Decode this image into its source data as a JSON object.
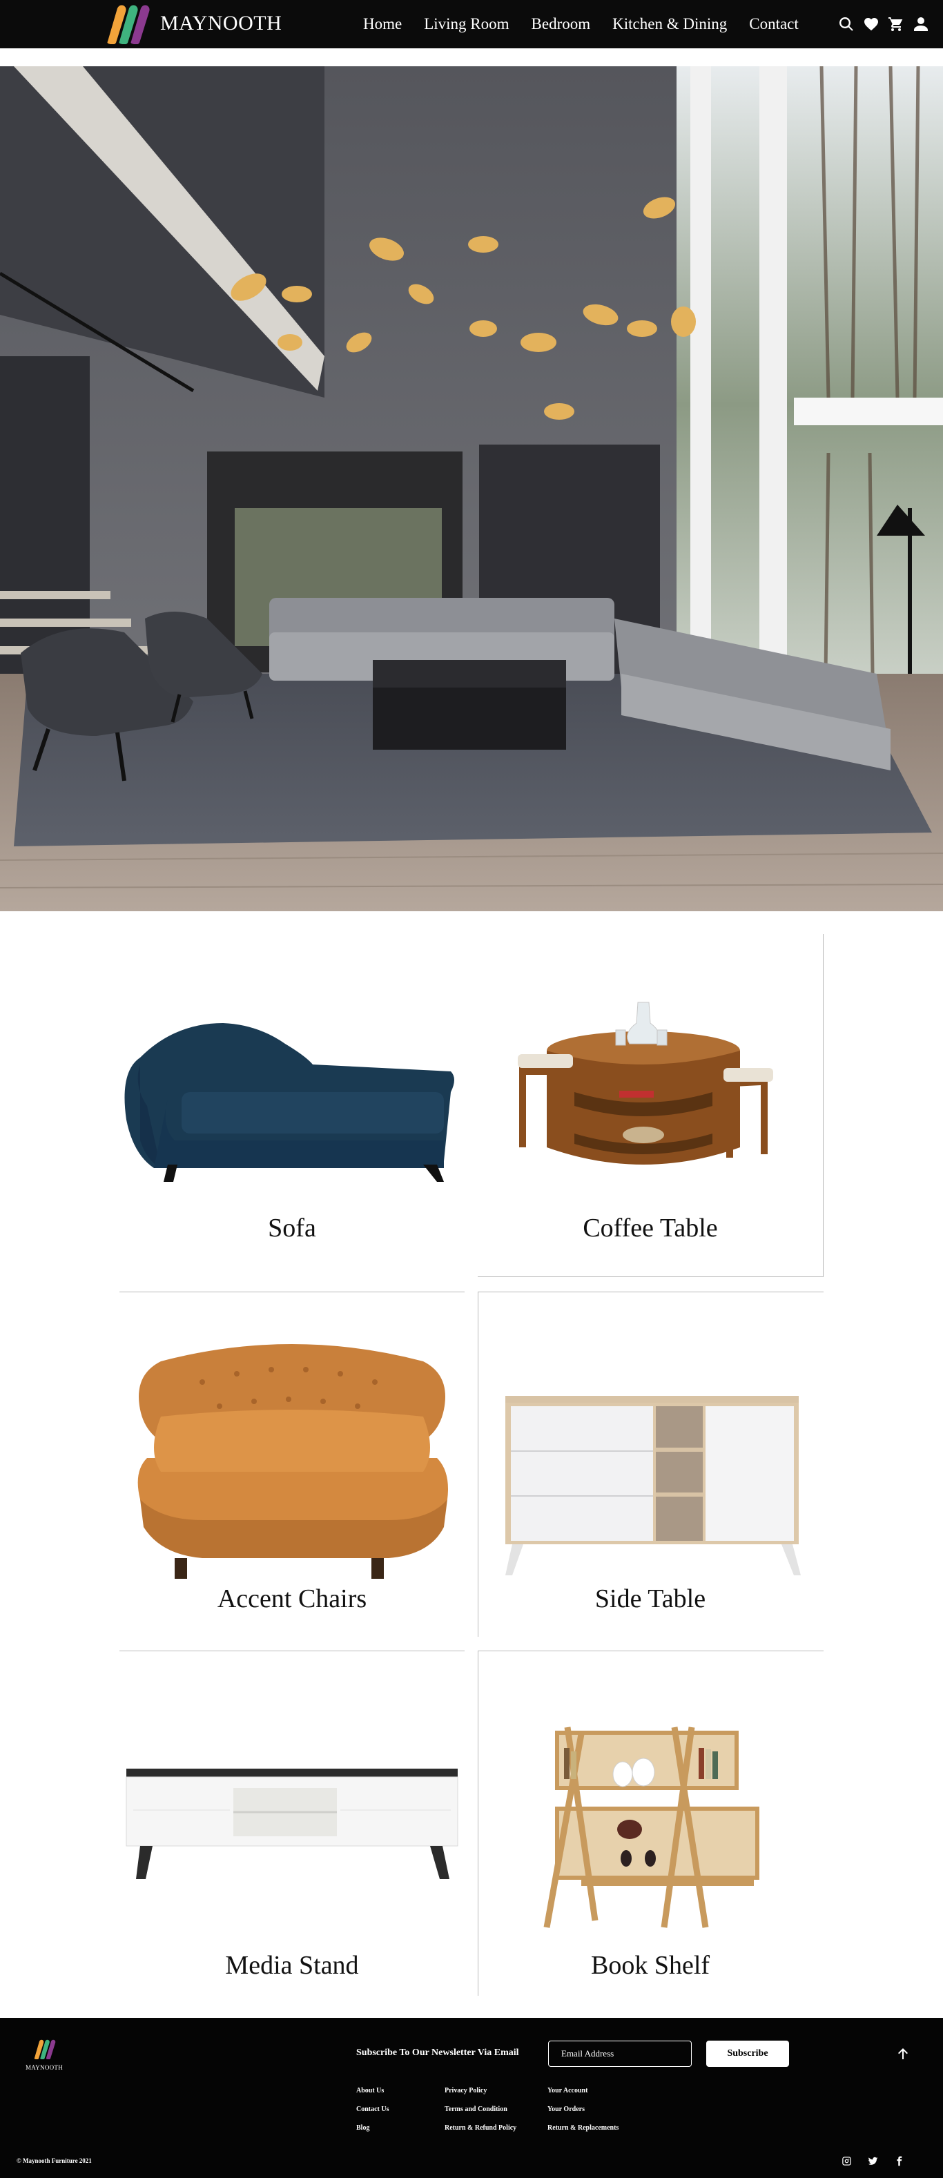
{
  "header": {
    "logo_text": "MAYNOOTH",
    "nav": [
      "Home",
      "Living Room",
      "Bedroom",
      "Kitchen & Dining",
      "Contact"
    ],
    "icons": [
      "search-icon",
      "heart-icon",
      "cart-icon",
      "user-icon"
    ]
  },
  "hero": {
    "image": "modern-living-room-photo"
  },
  "categories": [
    {
      "label": "Sofa",
      "image": "chaise-sofa"
    },
    {
      "label": "Coffee Table",
      "image": "round-coffee-table"
    },
    {
      "label": "Accent Chairs",
      "image": "tufted-armchair"
    },
    {
      "label": "Side Table",
      "image": "sideboard-cabinet"
    },
    {
      "label": "Media Stand",
      "image": "tv-media-stand"
    },
    {
      "label": "Book Shelf",
      "image": "wooden-book-shelf"
    }
  ],
  "footer": {
    "logo_text": "MAYNOOTH",
    "newsletter_title": "Subscribe To Our Newsletter Via Email",
    "email_placeholder": "Email Address",
    "subscribe_label": "Subscribe",
    "links_col1": [
      "About Us",
      "Contact Us",
      "Blog"
    ],
    "links_col2": [
      "Privacy Policy",
      "Terms and Condition",
      "Return & Refund Policy"
    ],
    "links_col3": [
      "Your Account",
      "Your Orders",
      "Return & Replacements"
    ],
    "copyright": "© Maynooth Furniture 2021",
    "socials": [
      "instagram-icon",
      "twitter-icon",
      "facebook-icon"
    ]
  },
  "colors": {
    "header_bg": "#0b0b0b",
    "footer_bg": "#050505",
    "logo_orange": "#f2a33a",
    "logo_green": "#3fb37f",
    "logo_purple": "#8b3a8f"
  }
}
